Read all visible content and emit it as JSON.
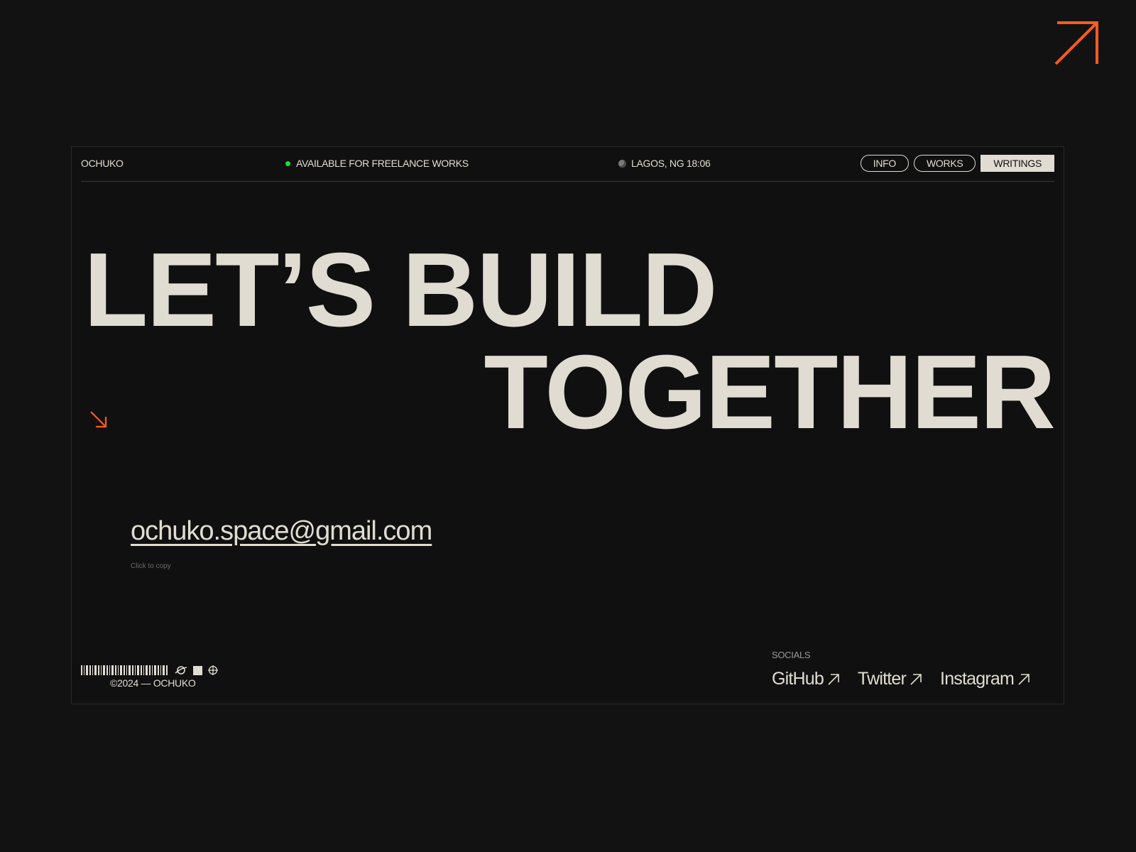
{
  "brand": "OCHUKO",
  "status": {
    "text": "AVAILABLE FOR FREELANCE WORKS",
    "dot_color": "#1fdc3a"
  },
  "location": {
    "text": "LAGOS, NG 18:06",
    "icon": "globe-icon"
  },
  "nav": [
    {
      "label": "INFO",
      "active": false
    },
    {
      "label": "WORKS",
      "active": false
    },
    {
      "label": "WRITINGS",
      "active": true
    }
  ],
  "hero": {
    "line1": "LET’S BUILD",
    "line2": "TOGETHER"
  },
  "contact": {
    "email": "ochuko.space@gmail.com",
    "hint": "Click to copy"
  },
  "footer": {
    "copyright": "©2024 — OCHUKO",
    "icons": [
      "barcode-icon",
      "planet-icon",
      "square-icon",
      "crosshair-icon"
    ]
  },
  "socials": {
    "label": "SOCIALS",
    "links": [
      "GitHub",
      "Twitter",
      "Instagram"
    ]
  },
  "colors": {
    "accent": "#ff5a1f",
    "background": "#121212",
    "text": "#e0dcd2"
  }
}
